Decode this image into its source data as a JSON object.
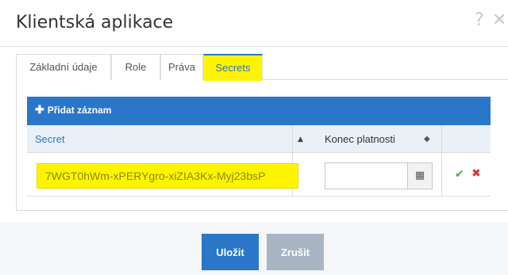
{
  "dialog": {
    "title": "Klientská aplikace",
    "help_glyph": "?",
    "close_glyph": "✕"
  },
  "tabs": [
    {
      "label": "Základní údaje",
      "active": false
    },
    {
      "label": "Role",
      "active": false
    },
    {
      "label": "Práva",
      "active": false
    },
    {
      "label": "Secrets",
      "active": true
    }
  ],
  "grid": {
    "add_label": "Přidat záznam",
    "columns": [
      {
        "label": "Secret",
        "sort": "asc"
      },
      {
        "label": "Konec platnosti",
        "sort": "both"
      }
    ],
    "rows": [
      {
        "secret": "7WGT0hWm-xPERYgro-xiZIA3Kx-Myj23bsP",
        "expiry": ""
      }
    ]
  },
  "footer": {
    "save_label": "Uložit",
    "cancel_label": "Zrušit"
  },
  "colors": {
    "accent": "#2a77c9",
    "highlight": "#fff400",
    "confirm": "#3fae49",
    "delete": "#d9342b"
  }
}
